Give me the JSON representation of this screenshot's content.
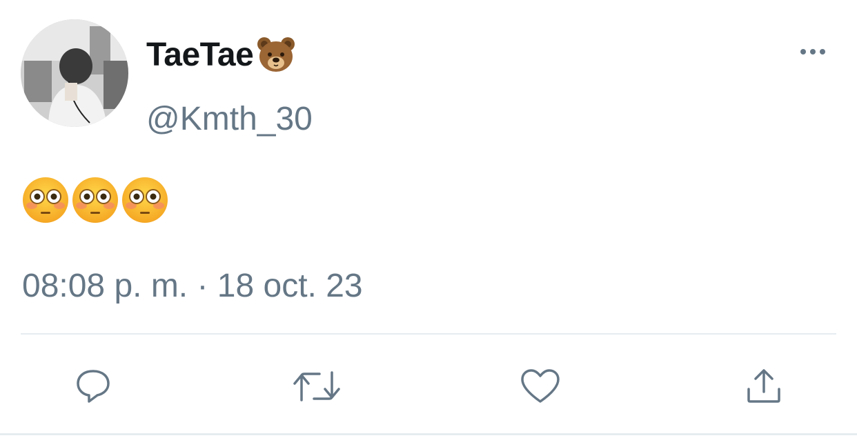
{
  "user": {
    "display_name": "TaeTae",
    "name_emoji": "bear-face-emoji",
    "handle": "@Kmth_30"
  },
  "tweet": {
    "emojis": [
      "flushed-face-emoji",
      "flushed-face-emoji",
      "flushed-face-emoji"
    ],
    "timestamp": "08:08 p. m. · 18 oct. 23"
  },
  "actions": {
    "reply_icon": "reply-icon",
    "retweet_icon": "retweet-icon",
    "like_icon": "heart-icon",
    "share_icon": "share-icon",
    "more_icon": "more-icon"
  },
  "colors": {
    "text_primary": "#14171a",
    "text_secondary": "#657786",
    "divider": "#e6ecf0"
  }
}
